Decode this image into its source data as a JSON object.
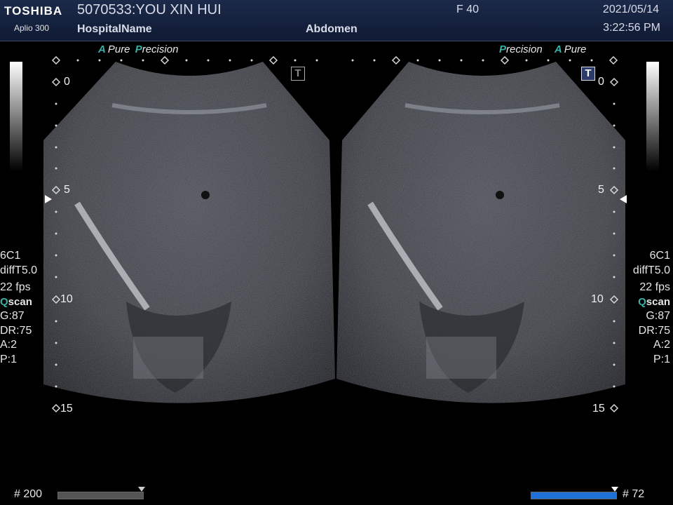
{
  "header": {
    "brand": "TOSHIBA",
    "model": "Aplio 300",
    "patient": "5070533:YOU XIN HUI",
    "hospital": "HospitalName",
    "exam": "Abdomen",
    "frame": "F  40",
    "date": "2021/05/14",
    "time": "3:22:56 PM"
  },
  "tags": {
    "left": {
      "a": "A",
      "pure": "Pure",
      "p": "P",
      "precision": "recision"
    },
    "right": {
      "p": "P",
      "precision": "recision",
      "a": "A",
      "pure": "Pure"
    }
  },
  "depth_labels": [
    "0",
    "5",
    "10",
    "15"
  ],
  "left_params": {
    "probe": "6C1",
    "mode": "diffT5.0",
    "fps": "22 fps",
    "q": "Q",
    "scan": "scan",
    "gain": "G:87",
    "dr": "DR:75",
    "a": "A:2",
    "p": "P:1"
  },
  "right_params": {
    "probe": "6C1",
    "mode": "diffT5.0",
    "fps": "22 fps",
    "q": "Q",
    "scan": "scan",
    "gain": "G:87",
    "dr": "DR:75",
    "a": "A:2",
    "p": "P:1"
  },
  "icons": {
    "left_t": "T",
    "right_t": "T"
  },
  "cine": {
    "left_label": "# 200",
    "right_label": "# 72",
    "left_color": "#555555",
    "right_color": "#1e6fd6"
  },
  "colors": {
    "accent": "#3ab0a6",
    "header": "#1c2a4a"
  }
}
